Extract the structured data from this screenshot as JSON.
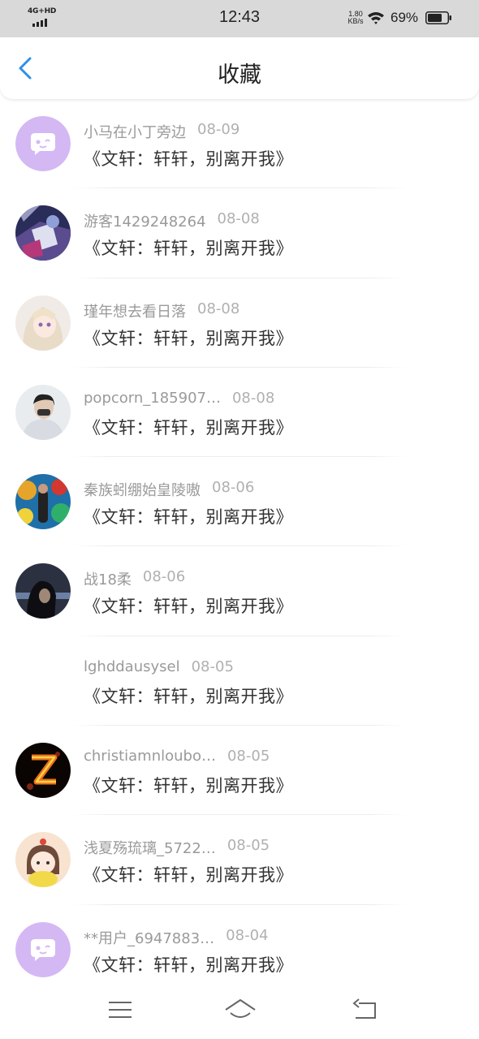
{
  "status_bar": {
    "network": "4G+HD",
    "time": "12:43",
    "speed_value": "1.80",
    "speed_unit": "KB/s",
    "battery": "69%"
  },
  "header": {
    "title": "收藏",
    "back_icon": "chevron-left-icon"
  },
  "colors": {
    "accent": "#2f8fe6",
    "meta_text": "#9a9a9a",
    "title_text": "#333333",
    "default_avatar": "#c7a8f0"
  },
  "favorites": [
    {
      "user": "小马在小丁旁边",
      "date": "08-09",
      "title": "《文轩：轩轩，别离开我》",
      "avatar": "default-chat-avatar"
    },
    {
      "user": "游客1429248264",
      "date": "08-08",
      "title": "《文轩：轩轩，别离开我》",
      "avatar": "anime-photo-avatar"
    },
    {
      "user": "瑾年想去看日落",
      "date": "08-08",
      "title": "《文轩：轩轩，别离开我》",
      "avatar": "anime-girl-avatar"
    },
    {
      "user": "popcorn_185907…",
      "date": "08-08",
      "title": "《文轩：轩轩，别离开我》",
      "avatar": "photo-avatar"
    },
    {
      "user": "秦族蚓绷始皇陵嗷",
      "date": "08-06",
      "title": "《文轩：轩轩，别离开我》",
      "avatar": "graffiti-photo-avatar"
    },
    {
      "user": "战18柔",
      "date": "08-06",
      "title": "《文轩：轩轩，别离开我》",
      "avatar": "dark-photo-avatar"
    },
    {
      "user": "lghddausysel",
      "date": "08-05",
      "title": "《文轩：轩轩，别离开我》",
      "avatar": "blank-avatar"
    },
    {
      "user": "christiamnloubo…",
      "date": "08-05",
      "title": "《文轩：轩轩，别离开我》",
      "avatar": "fire-z-avatar"
    },
    {
      "user": "浅夏殇琉璃_5722…",
      "date": "08-05",
      "title": "《文轩：轩轩，别离开我》",
      "avatar": "cartoon-girl-avatar"
    },
    {
      "user": "**用户_6947883…",
      "date": "08-04",
      "title": "《文轩：轩轩，别离开我》",
      "avatar": "default-chat-avatar"
    }
  ],
  "bottom_nav": {
    "menu_icon": "menu-icon",
    "home_icon": "home-icon",
    "back_icon": "back-icon"
  }
}
